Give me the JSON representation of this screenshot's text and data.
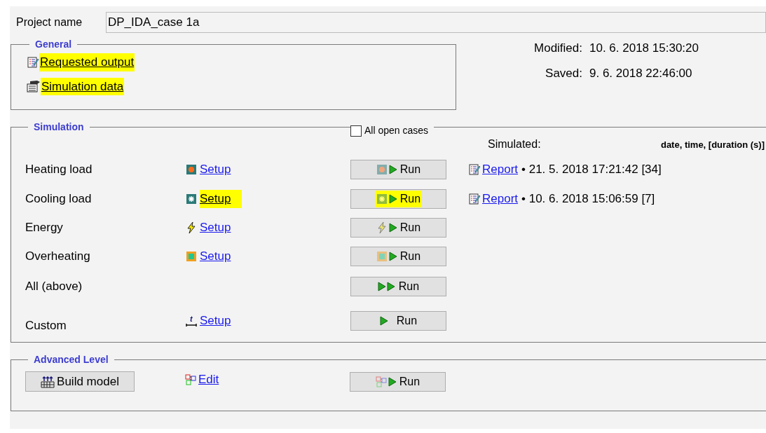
{
  "project": {
    "label": "Project name",
    "value": "DP_IDA_case 1a"
  },
  "general": {
    "title": "General",
    "links": [
      {
        "label": "Requested output",
        "kind": "report",
        "highlighted": true
      },
      {
        "label": "Simulation data",
        "kind": "data",
        "highlighted": true
      }
    ]
  },
  "info": [
    {
      "label": "Modified:",
      "value": "10. 6. 2018 15:30:20"
    },
    {
      "label": "Saved:",
      "value": "9. 6. 2018 22:46:00"
    }
  ],
  "simulation": {
    "title": "Simulation",
    "all_open_cases": {
      "label": "All open cases",
      "checked": false
    },
    "simulated_label": "Simulated:",
    "columns_hint": "date, time, [duration (s)]",
    "rows": [
      {
        "label": "Heating load",
        "kind": "heating",
        "setup": "Setup",
        "setup_highlighted": false,
        "run": "Run",
        "run_highlighted": false,
        "report": "Report",
        "result": "• 21. 5. 2018 17:21:42 [34]"
      },
      {
        "label": "Cooling load",
        "kind": "cooling",
        "setup": "Setup",
        "setup_highlighted": true,
        "run": "Run",
        "run_highlighted": true,
        "report": "Report",
        "result": "• 10. 6. 2018 15:06:59 [7]"
      },
      {
        "label": "Energy",
        "kind": "energy",
        "setup": "Setup",
        "setup_highlighted": false,
        "run": "Run",
        "run_highlighted": false
      },
      {
        "label": "Overheating",
        "kind": "overheating",
        "setup": "Setup",
        "setup_highlighted": false,
        "run": "Run",
        "run_highlighted": false
      },
      {
        "label": "All (above)",
        "kind": "all",
        "run": "Run",
        "run_highlighted": false
      },
      {
        "label": "Custom",
        "kind": "custom",
        "icon_glyph": "t",
        "setup": "Setup",
        "setup_highlighted": false,
        "run": "Run",
        "run_highlighted": false
      }
    ]
  },
  "advanced": {
    "title": "Advanced Level",
    "build": "Build model",
    "edit": "Edit",
    "run": "Run"
  }
}
